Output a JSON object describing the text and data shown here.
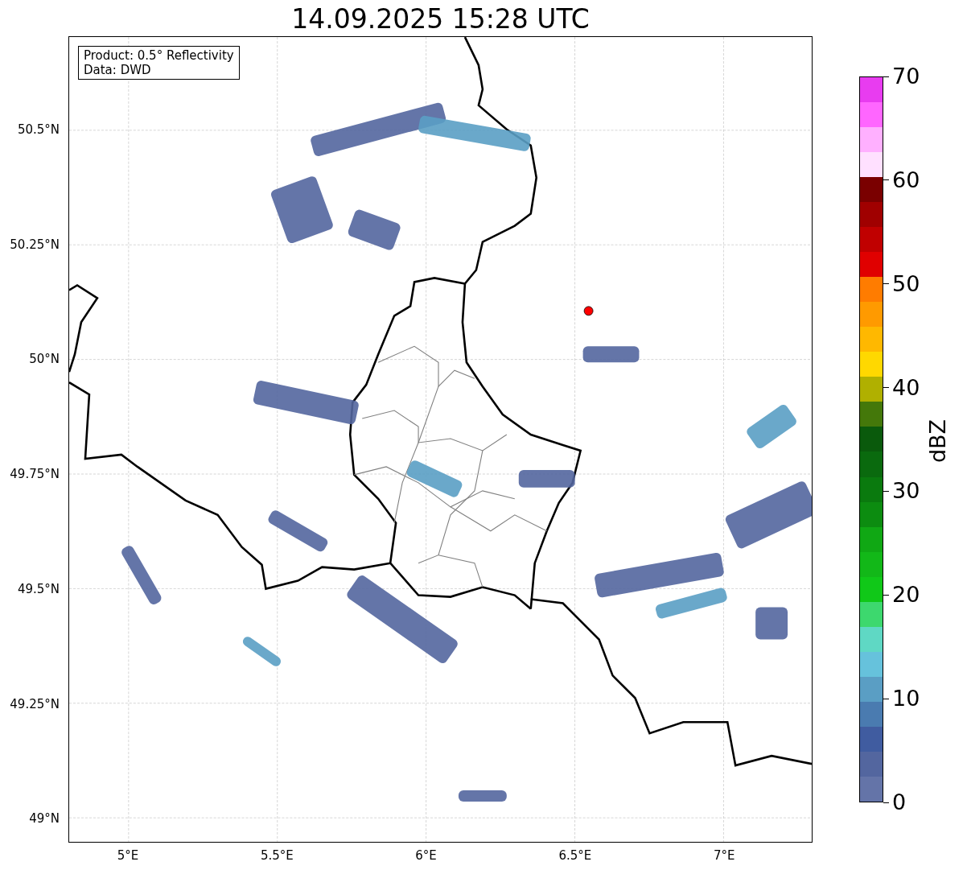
{
  "title": "14.09.2025 15:28 UTC",
  "info_box": [
    "Product: 0.5° Reflectivity",
    "Data: DWD"
  ],
  "map": {
    "lat_ticks": [
      "50.5°N",
      "50.25°N",
      "50°N",
      "49.75°N",
      "49.5°N",
      "49.25°N",
      "49°N"
    ],
    "lon_ticks": [
      "5°E",
      "5.5°E",
      "6°E",
      "6.5°E",
      "7°E"
    ]
  },
  "colorbar": {
    "label": "dBZ",
    "ticks": [
      "70",
      "60",
      "50",
      "40",
      "30",
      "20",
      "10",
      "0"
    ],
    "bins": [
      {
        "color": "#e83cf0"
      },
      {
        "color": "#ff66ff"
      },
      {
        "color": "#ffb0ff"
      },
      {
        "color": "#ffe0ff"
      },
      {
        "color": "#7a0000"
      },
      {
        "color": "#a00000"
      },
      {
        "color": "#c00000"
      },
      {
        "color": "#e00000"
      },
      {
        "color": "#ff7c00"
      },
      {
        "color": "#ff9a00"
      },
      {
        "color": "#ffb800"
      },
      {
        "color": "#ffd800"
      },
      {
        "color": "#b0b000"
      },
      {
        "color": "#44780a"
      },
      {
        "color": "#0a5a0c"
      },
      {
        "color": "#0a6a0e"
      },
      {
        "color": "#0a7a0e"
      },
      {
        "color": "#0c8c10"
      },
      {
        "color": "#10a814"
      },
      {
        "color": "#12b818"
      },
      {
        "color": "#10c818"
      },
      {
        "color": "#3dd86e"
      },
      {
        "color": "#5fd8c4"
      },
      {
        "color": "#66c2dc"
      },
      {
        "color": "#5a9ec4"
      },
      {
        "color": "#4a7bb0"
      },
      {
        "color": "#405ca0"
      },
      {
        "color": "#53669f"
      },
      {
        "color": "#6474a8"
      }
    ]
  }
}
